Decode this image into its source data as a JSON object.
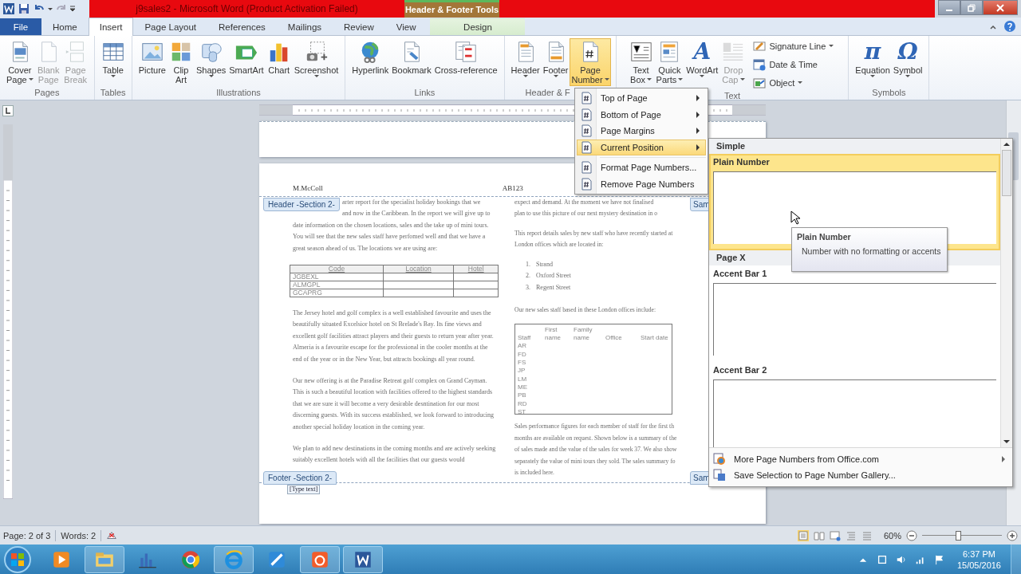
{
  "window": {
    "title": "j9sales2  -  Microsoft Word (Product Activation Failed)",
    "context_group": "Header & Footer Tools"
  },
  "tabs": [
    {
      "label": "File",
      "kind": "file",
      "selected": false
    },
    {
      "label": "Home",
      "kind": "normal",
      "selected": false
    },
    {
      "label": "Insert",
      "kind": "normal",
      "selected": true
    },
    {
      "label": "Page Layout",
      "kind": "normal",
      "selected": false
    },
    {
      "label": "References",
      "kind": "normal",
      "selected": false
    },
    {
      "label": "Mailings",
      "kind": "normal",
      "selected": false
    },
    {
      "label": "Review",
      "kind": "normal",
      "selected": false
    },
    {
      "label": "View",
      "kind": "normal",
      "selected": false
    },
    {
      "label": "Design",
      "kind": "context",
      "selected": false
    }
  ],
  "ribbon_groups": [
    {
      "label": "Pages",
      "buttons": [
        {
          "kind": "large",
          "label_lines": [
            "Cover",
            "Page"
          ],
          "dropdown": true,
          "disabled": false,
          "selected": false
        },
        {
          "kind": "large",
          "label_lines": [
            "Blank",
            "Page"
          ],
          "dropdown": false,
          "disabled": true,
          "selected": false
        },
        {
          "kind": "large",
          "label_lines": [
            "Page",
            "Break"
          ],
          "dropdown": false,
          "disabled": true,
          "selected": false
        }
      ]
    },
    {
      "label": "Tables",
      "buttons": [
        {
          "kind": "large",
          "label_lines": [
            "Table"
          ],
          "dropdown": true,
          "disabled": false,
          "selected": false
        }
      ]
    },
    {
      "label": "Illustrations",
      "buttons": [
        {
          "kind": "large",
          "label_lines": [
            "Picture"
          ],
          "dropdown": false,
          "disabled": false,
          "selected": false
        },
        {
          "kind": "large",
          "label_lines": [
            "Clip",
            "Art"
          ],
          "dropdown": false,
          "disabled": false,
          "selected": false
        },
        {
          "kind": "large",
          "label_lines": [
            "Shapes"
          ],
          "dropdown": true,
          "disabled": false,
          "selected": false
        },
        {
          "kind": "large",
          "label_lines": [
            "SmartArt"
          ],
          "dropdown": false,
          "disabled": false,
          "selected": false
        },
        {
          "kind": "large",
          "label_lines": [
            "Chart"
          ],
          "dropdown": false,
          "disabled": false,
          "selected": false
        },
        {
          "kind": "large",
          "label_lines": [
            "Screenshot"
          ],
          "dropdown": true,
          "disabled": false,
          "selected": false
        }
      ]
    },
    {
      "label": "Links",
      "buttons": [
        {
          "kind": "large",
          "label_lines": [
            "Hyperlink"
          ],
          "dropdown": false,
          "disabled": false,
          "selected": false
        },
        {
          "kind": "large",
          "label_lines": [
            "Bookmark"
          ],
          "dropdown": false,
          "disabled": false,
          "selected": false
        },
        {
          "kind": "large",
          "label_lines": [
            "Cross-reference"
          ],
          "dropdown": false,
          "disabled": false,
          "selected": false
        }
      ]
    },
    {
      "label": "Header & F",
      "buttons": [
        {
          "kind": "large",
          "label_lines": [
            "Header"
          ],
          "dropdown": true,
          "disabled": false,
          "selected": false
        },
        {
          "kind": "large",
          "label_lines": [
            "Footer"
          ],
          "dropdown": true,
          "disabled": false,
          "selected": false
        },
        {
          "kind": "large",
          "label_lines": [
            "Page",
            "Number"
          ],
          "dropdown": true,
          "disabled": false,
          "selected": true
        }
      ]
    },
    {
      "label": "Text",
      "buttons": [
        {
          "kind": "large",
          "label_lines": [
            "Text",
            "Box"
          ],
          "dropdown": true,
          "disabled": false,
          "selected": false
        },
        {
          "kind": "large",
          "label_lines": [
            "Quick",
            "Parts"
          ],
          "dropdown": true,
          "disabled": false,
          "selected": false
        },
        {
          "kind": "large",
          "label_lines": [
            "WordArt"
          ],
          "glyph": "A",
          "dropdown": true,
          "disabled": false,
          "selected": false
        },
        {
          "kind": "large",
          "label_lines": [
            "Drop",
            "Cap"
          ],
          "dropdown": true,
          "disabled": true,
          "selected": false
        },
        {
          "kind": "small",
          "label_lines": [
            "Signature Line"
          ],
          "dropdown": true,
          "disabled": false,
          "selected": false
        },
        {
          "kind": "small",
          "label_lines": [
            "Date & Time"
          ],
          "dropdown": false,
          "disabled": false,
          "selected": false
        },
        {
          "kind": "small",
          "label_lines": [
            "Object"
          ],
          "dropdown": true,
          "disabled": false,
          "selected": false
        }
      ]
    },
    {
      "label": "Symbols",
      "buttons": [
        {
          "kind": "large",
          "label_lines": [
            "Equation"
          ],
          "glyph": "π",
          "dropdown": true,
          "disabled": false,
          "selected": false
        },
        {
          "kind": "large",
          "label_lines": [
            "Symbol"
          ],
          "glyph": "Ω",
          "dropdown": true,
          "disabled": false,
          "selected": false
        }
      ]
    }
  ],
  "document": {
    "header": {
      "left": "M.McColl",
      "right": "AB123",
      "tag": "Header -Section 2-",
      "right_tag": "Sam"
    },
    "left_column": [
      {
        "kind": "lines",
        "indent": true,
        "lines": [
          "arter report for the specialist holiday bookings that we",
          "and now in the Caribbean. In the report we will give up to"
        ]
      },
      {
        "kind": "paragraph",
        "text": "date information on the chosen locations, sales and the take up of mini tours.  You will see that the new sales staff have perfomed well and that we have a great season ahead of us. The locations we are using are:"
      },
      {
        "kind": "table",
        "columns": [
          "Code",
          "Location",
          "Hotel"
        ],
        "rows": [
          [
            "JGBEXL"
          ],
          [
            "ALMGPL"
          ],
          [
            "GCAPRG"
          ]
        ]
      },
      {
        "kind": "paragraph",
        "text": "The Jersey hotel and golf complex is a well established favourite and uses the beautifully situated Excelsior hotel on St Brelade's Bay. Its fine views and excellent golf facilities attract players and their guests to return year after year. Almeria is a favourite escape for the professional in the cooler months at the end of the year or in the New Year, but attracts bookings all year round."
      },
      {
        "kind": "paragraph",
        "text": "Our new offering is at the Paradise Retreat golf complex on Grand Cayman. This is such a beautiful location with facilities offered to the highest standards that we are sure it will become a very desirable desntination for our most discerning guests. With its success established, we look forward to introducing another special holiday location in the coming year."
      },
      {
        "kind": "paragraph",
        "text": "We plan to add new destinations in the coming months and are actively seeking suitably excellent hotels with all the facilities that our guests would"
      }
    ],
    "right_column": [
      {
        "kind": "lines",
        "lines": [
          "expect and demand. At the moment we have not finalised",
          "plan to use this picture of our next mystery destination in o"
        ]
      },
      {
        "kind": "lines",
        "lines": [
          "This report details sales by new staff who have recently started at",
          "London offices which are located in:"
        ]
      },
      {
        "kind": "list",
        "items": [
          {
            "number": "1.",
            "text": "Strand"
          },
          {
            "number": "2.",
            "text": "Oxford Street"
          },
          {
            "number": "3.",
            "text": "Regent Street"
          }
        ]
      },
      {
        "kind": "lines",
        "lines": [
          "Our new sales staff based in these London offices include:"
        ]
      },
      {
        "kind": "staff_table",
        "columns": [
          "Staff",
          "First name",
          "Family name",
          "Office",
          "Start date"
        ],
        "rows": [
          "AR",
          "FD",
          "FS",
          "JP",
          "LM",
          "ME",
          "PB",
          "RD",
          "ST"
        ]
      },
      {
        "kind": "lines",
        "lines": [
          "Sales performance figures for each member of staff for the first th",
          "months are available on request. Shown below is a summary of the",
          "of sales made and the value of the sales for week 37. We also show",
          "separately the value of mini tours they sold. The sales summary fo",
          "is included here."
        ]
      }
    ],
    "footer": {
      "tag": "Footer -Section 2-",
      "field": "[Type text]",
      "right_tag": "Sam"
    }
  },
  "page_number_menu": [
    {
      "label": "Top of Page",
      "submenu": true,
      "selected": false
    },
    {
      "label": "Bottom of Page",
      "submenu": true,
      "selected": false
    },
    {
      "label": "Page Margins",
      "submenu": true,
      "selected": false
    },
    {
      "label": "Current Position",
      "submenu": true,
      "selected": true
    },
    {
      "label": "Format Page Numbers...",
      "submenu": false,
      "selected": false
    },
    {
      "label": "Remove Page Numbers",
      "submenu": false,
      "selected": false
    }
  ],
  "gallery": {
    "sections": [
      {
        "heading": "Simple",
        "items": [
          {
            "label": "Plain Number",
            "selected": true
          }
        ]
      },
      {
        "heading": "Page X",
        "items": [
          {
            "label": "Accent Bar 1",
            "selected": false
          },
          {
            "label": "Accent Bar 2",
            "selected": false
          }
        ]
      }
    ],
    "footer_items": [
      {
        "label": "More Page Numbers from Office.com",
        "submenu": true
      },
      {
        "label": "Save Selection to Page Number Gallery...",
        "submenu": false
      }
    ]
  },
  "tooltip": {
    "title": "Plain Number",
    "text": "Number with no formatting or accents"
  },
  "status_bar": {
    "page": "Page: 2 of 3",
    "words": "Words: 2",
    "zoom": "60%",
    "zoom_slider": {
      "level": 0.45
    }
  },
  "taskbar": {
    "time": "6:37 PM",
    "date": "15/05/2016"
  }
}
